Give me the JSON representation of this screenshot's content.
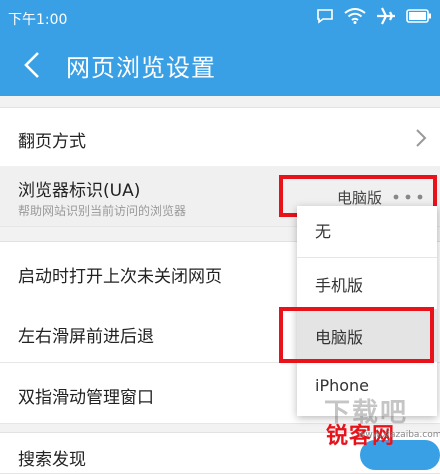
{
  "status_bar": {
    "time": "下午1:00"
  },
  "header": {
    "title": "网页浏览设置"
  },
  "settings": {
    "page_turn_label": "翻页方式",
    "ua_label": "浏览器标识(UA)",
    "ua_subtitle": "帮助网站识别当前访问的浏览器",
    "ua_value": "电脑版",
    "reopen_label": "启动时打开上次未关闭网页",
    "swipe_label": "左右滑屏前进后退",
    "two_finger_label": "双指滑动管理窗口",
    "search_discover_label": "搜索发现"
  },
  "ua_dropdown": {
    "options": [
      "无",
      "手机版",
      "电脑版",
      "iPhone"
    ],
    "selected": "电脑版"
  },
  "watermark": {
    "top": "下载吧",
    "bottom": "锐客网",
    "url": "www.xiazaiba.com"
  },
  "colors": {
    "accent": "#3aa0e6",
    "highlight": "#e8121a"
  }
}
